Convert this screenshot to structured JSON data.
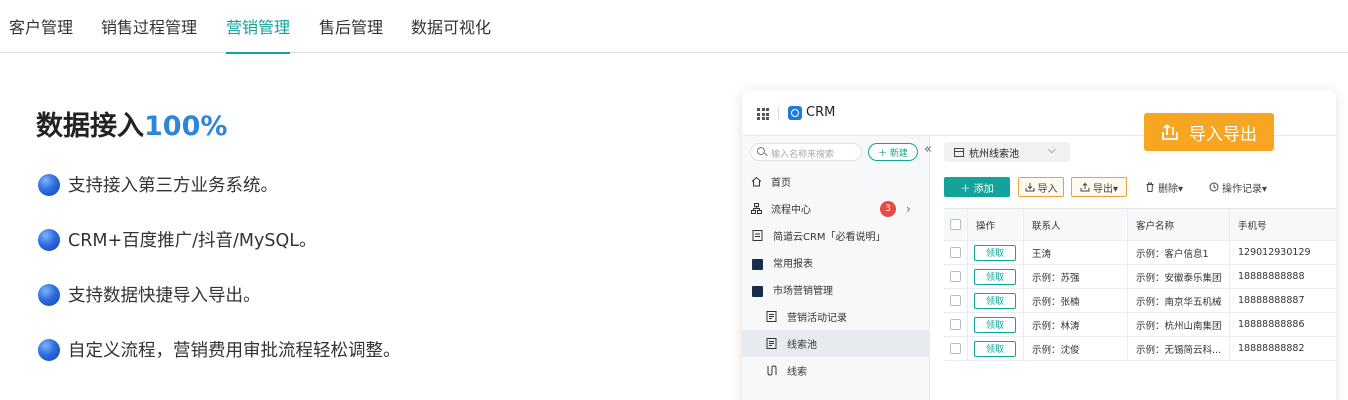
{
  "tabs": [
    {
      "label": "客户管理",
      "active": false
    },
    {
      "label": "销售过程管理",
      "active": false
    },
    {
      "label": "营销管理",
      "active": true
    },
    {
      "label": "售后管理",
      "active": false
    },
    {
      "label": "数据可视化",
      "active": false
    }
  ],
  "accent_color": "#14a39a",
  "headline": {
    "text": "数据接入",
    "percent": "100%"
  },
  "features": [
    "支持接入第三方业务系统。",
    "CRM+百度推广/抖音/MySQL。",
    "支持数据快捷导入导出。",
    "自定义流程，营销费用审批流程轻松调整。"
  ],
  "crm": {
    "app_title": "CRM",
    "import_badge": "导入导出",
    "search_placeholder": "输入名称来搜索",
    "new_button": "＋ 新建",
    "collapse_icon": "«",
    "nav": [
      {
        "label": "首页",
        "icon": "home-icon"
      },
      {
        "label": "流程中心",
        "icon": "flow-icon",
        "badge": "3",
        "chevron": "›"
      },
      {
        "label": "简道云CRM「必看说明」",
        "icon": "doc-icon"
      },
      {
        "label": "常用报表",
        "icon": "folder-icon"
      },
      {
        "label": "市场营销管理",
        "icon": "folder-open-icon"
      },
      {
        "label": "营销活动记录",
        "icon": "form-icon"
      },
      {
        "label": "线索池",
        "icon": "form-icon",
        "selected": true
      },
      {
        "label": "线索",
        "icon": "lead-icon"
      }
    ],
    "pool_select": "杭州线索池",
    "pool_select_arrow": "⌵",
    "toolbar": {
      "add": "＋ 添加",
      "import": "导入",
      "export": "导出▾",
      "delete": "删除▾",
      "log": "操作记录▾"
    },
    "table": {
      "headers": [
        "操作",
        "联系人",
        "客户名称",
        "手机号"
      ],
      "claim_label": "领取",
      "rows": [
        {
          "contact": "王涛",
          "customer": "示例：客户信息1",
          "phone": "129012930129"
        },
        {
          "contact": "示例：苏强",
          "customer": "示例：安徽泰乐集团",
          "phone": "18888888888"
        },
        {
          "contact": "示例：张楠",
          "customer": "示例：南京华五机械",
          "phone": "18888888887"
        },
        {
          "contact": "示例：林涛",
          "customer": "示例：杭州山南集团",
          "phone": "18888888886"
        },
        {
          "contact": "示例：沈俊",
          "customer": "示例：无锡简云科...",
          "phone": "18888888882"
        }
      ]
    }
  }
}
